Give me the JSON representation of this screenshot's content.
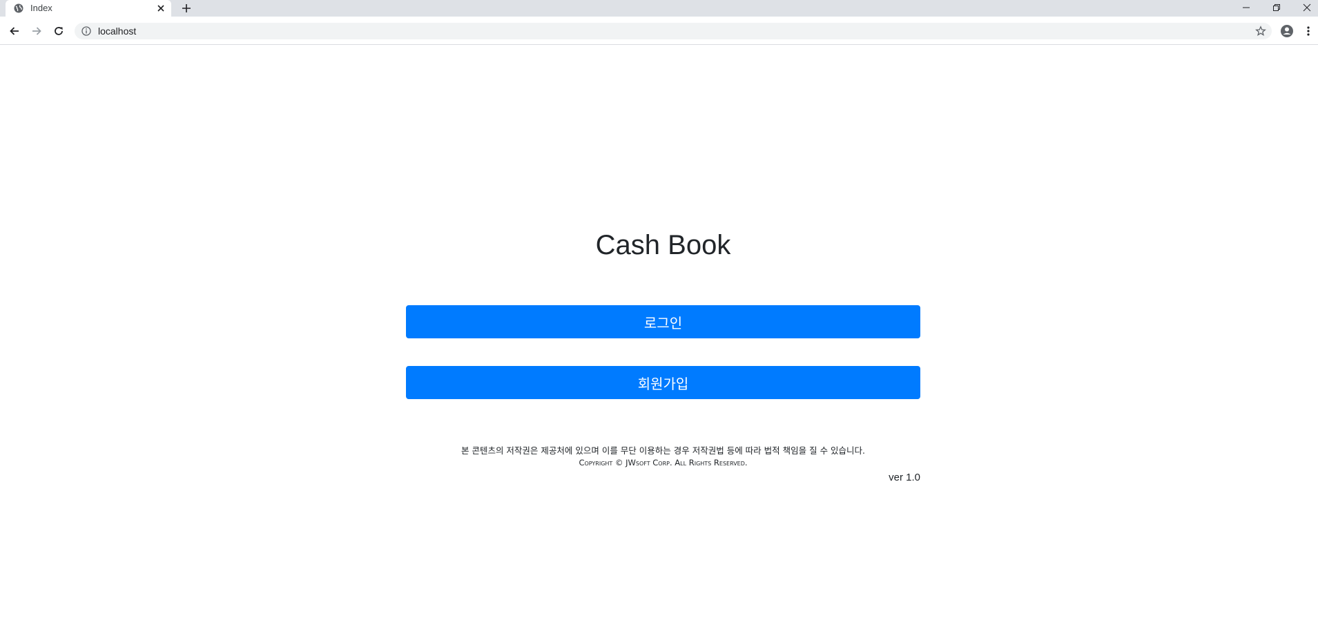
{
  "browser": {
    "tab_title": "Index",
    "url": "localhost"
  },
  "page": {
    "title": "Cash Book",
    "login_label": "로그인",
    "signup_label": "회원가입",
    "notice": "본 콘텐츠의 저작권은 제공처에 있으며 이를 무단 이용하는 경우 저작권법 등에 따라 법적 책임을 질 수 있습니다.",
    "copyright": "Copyright © JWsoft Corp. All Rights Reserved.",
    "version": "ver 1.0"
  },
  "colors": {
    "primary": "#007bff",
    "text": "#212529",
    "tabstrip": "#dee1e6",
    "omnibox": "#f1f3f4"
  },
  "icons": [
    "globe-icon",
    "close-icon",
    "plus-icon",
    "minimize-icon",
    "restore-icon",
    "back-arrow-icon",
    "forward-arrow-icon",
    "reload-icon",
    "info-icon",
    "star-icon",
    "profile-icon",
    "more-vert-icon"
  ]
}
